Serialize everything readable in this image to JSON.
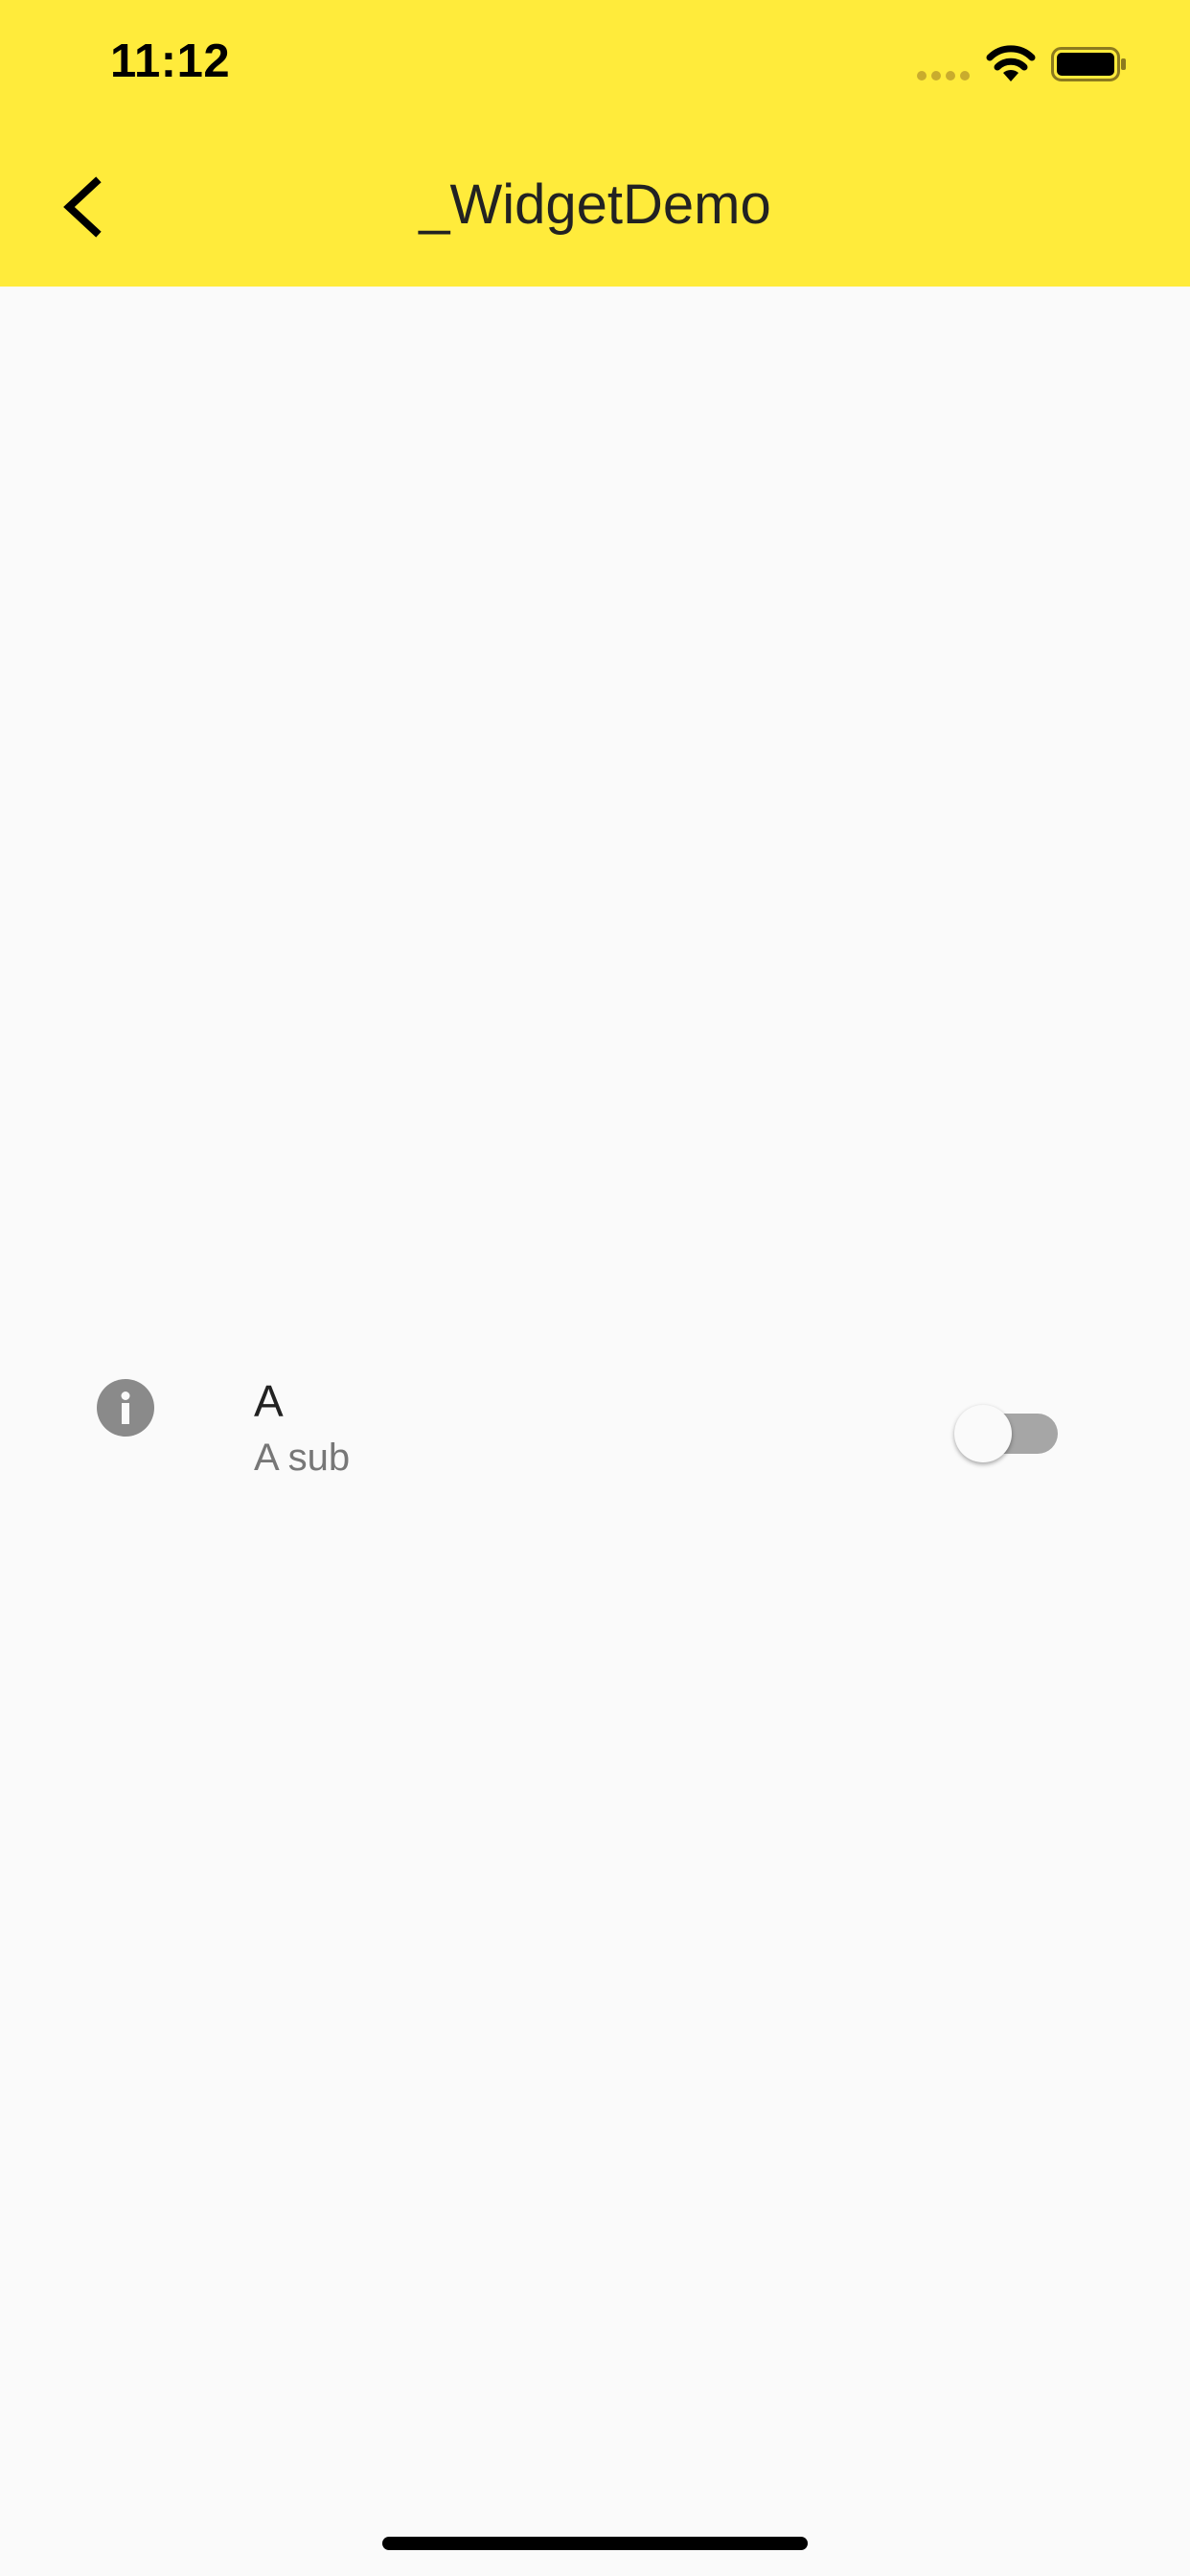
{
  "status_bar": {
    "time": "11:12",
    "icons": [
      "cellular-signal-icon",
      "wifi-icon",
      "battery-icon"
    ]
  },
  "app_bar": {
    "title": "_WidgetDemo",
    "back_icon": "chevron-left-icon",
    "background_color": "#ffeb3b"
  },
  "list_tile": {
    "leading_icon": "info-icon",
    "title": "A",
    "subtitle": "A sub",
    "switch_on": false
  },
  "colors": {
    "background": "#fafafa",
    "accent": "#ffeb3b",
    "icon_gray": "#8a8a8a",
    "switch_track_off": "#a6a6a6"
  }
}
